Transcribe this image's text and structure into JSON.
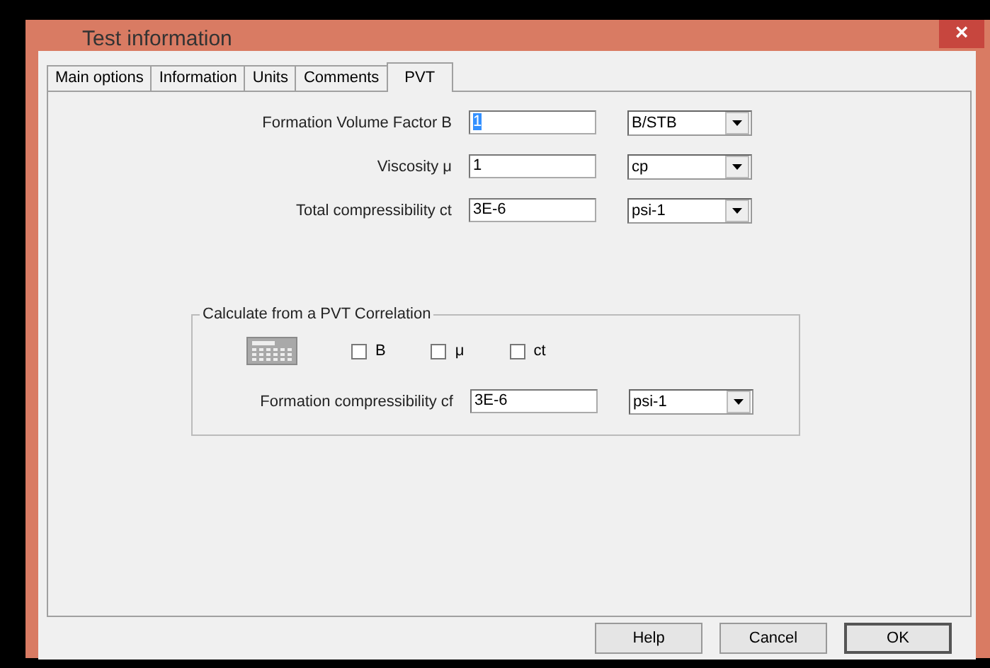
{
  "window": {
    "title": "Test information",
    "close": "×"
  },
  "tabs": [
    {
      "label": "Main options",
      "selected": false
    },
    {
      "label": "Information",
      "selected": false
    },
    {
      "label": "Units",
      "selected": false
    },
    {
      "label": "Comments",
      "selected": false
    },
    {
      "label": "PVT",
      "selected": true
    }
  ],
  "fields": [
    {
      "label": "Formation Volume Factor B",
      "value": "1",
      "text_selected": true,
      "unit": "B/STB"
    },
    {
      "label": "Viscosity μ",
      "value": "1",
      "text_selected": false,
      "unit": "cp"
    },
    {
      "label": "Total compressibility ct",
      "value": "3E-6",
      "text_selected": false,
      "unit": "psi-1"
    }
  ],
  "correlation": {
    "title": "Calculate from a PVT Correlation",
    "checkboxes": [
      {
        "label": "B",
        "checked": false
      },
      {
        "label": "μ",
        "checked": false
      },
      {
        "label": "ct",
        "checked": false
      }
    ],
    "field": {
      "label": "Formation compressibility cf",
      "value": "3E-6",
      "text_selected": false,
      "unit": "psi-1"
    }
  },
  "buttons": [
    {
      "label": "Help",
      "default": false
    },
    {
      "label": "Cancel",
      "default": false
    },
    {
      "label": "OK",
      "default": true
    }
  ]
}
